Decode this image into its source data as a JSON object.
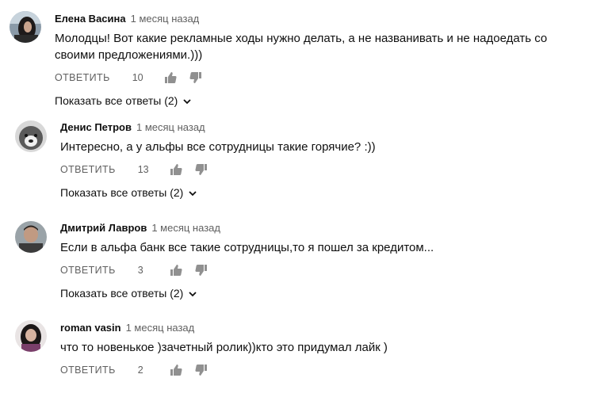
{
  "comments": [
    {
      "author": "Елена Васина",
      "time": "1 месяц назад",
      "text": "Молодцы! Вот какие рекламные ходы нужно делать, а не названивать и не надоедать со своими предложениями.)))",
      "reply_label": "ОТВЕТИТЬ",
      "likes": "10",
      "show_replies": "Показать все ответы (2)",
      "avatar_icon": "user-avatar-dark-hair"
    },
    {
      "author": "Денис Петров",
      "time": "1 месяц назад",
      "text": "Интересно, а у альфы все сотрудницы такие горячие? :))",
      "reply_label": "ОТВЕТИТЬ",
      "likes": "13",
      "show_replies": "Показать все ответы (2)",
      "avatar_icon": "user-avatar-dog"
    },
    {
      "author": "Дмитрий Лавров",
      "time": "1 месяц назад",
      "text": "Если в альфа банк все такие сотрудницы,то я пошел за кредитом...",
      "reply_label": "ОТВЕТИТЬ",
      "likes": "3",
      "show_replies": "Показать все ответы (2)",
      "avatar_icon": "user-avatar-man"
    },
    {
      "author": "roman vasin",
      "time": "1 месяц назад",
      "text": "что то новенькое )зачетный ролик))кто это придумал лайк )",
      "reply_label": "ОТВЕТИТЬ",
      "likes": "2",
      "avatar_icon": "user-avatar-woman"
    }
  ],
  "icons": {
    "like": "thumb-up-icon",
    "dislike": "thumb-down-icon",
    "expand": "chevron-down-icon"
  },
  "colors": {
    "text": "#0f0f0f",
    "secondary": "#606060",
    "icon": "#909090"
  }
}
